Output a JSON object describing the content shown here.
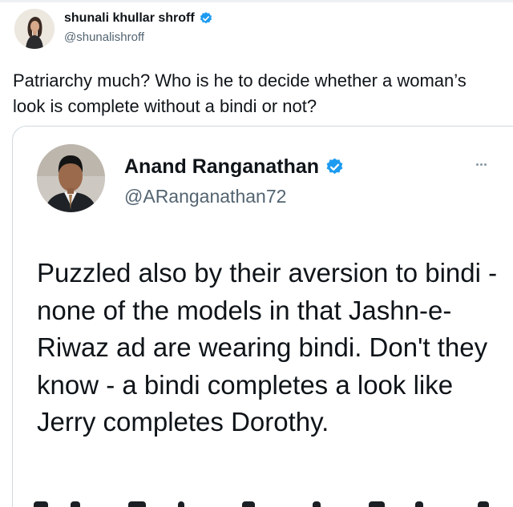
{
  "outer_tweet": {
    "display_name": "shunali khullar shroff",
    "handle": "@shunalishroff",
    "verified_icon": "verified-badge-icon",
    "text": "Patriarchy much? Who is he to decide whether a woman’s look is complete without a bindi or not?"
  },
  "quoted_tweet": {
    "display_name": "Anand Ranganathan",
    "handle": "@ARanganathan72",
    "verified_icon": "verified-badge-icon",
    "more_icon": "more-options-icon",
    "text": "Puzzled also by their aversion to bindi - none of the models in that Jashn-e-Riwaz ad are wearing bindi. Don't they know - a bindi completes a look like Jerry completes Dorothy."
  },
  "colors": {
    "verified_blue": "#1d9bf0",
    "text_primary": "#0f1419",
    "text_secondary": "#536471",
    "card_border": "#cfd9de"
  }
}
